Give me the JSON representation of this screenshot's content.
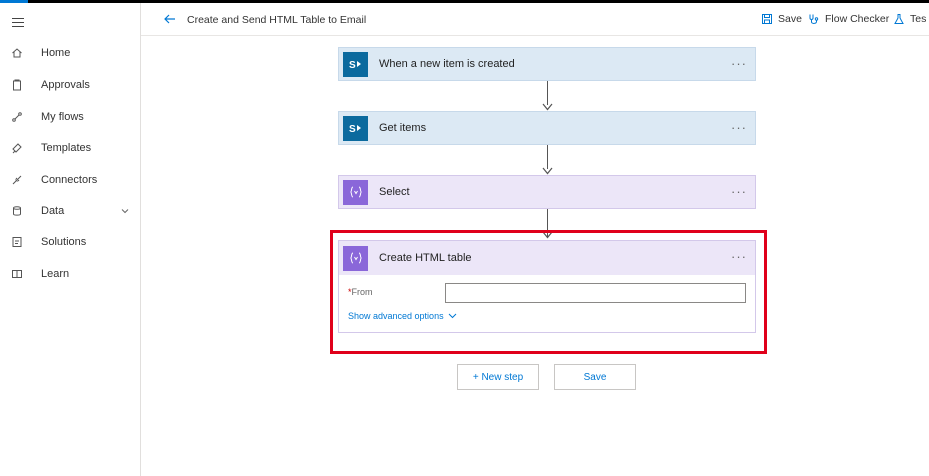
{
  "sidebar": {
    "items": [
      {
        "label": "Home",
        "icon": "home-icon"
      },
      {
        "label": "Approvals",
        "icon": "approvals-icon"
      },
      {
        "label": "My flows",
        "icon": "flows-icon"
      },
      {
        "label": "Templates",
        "icon": "templates-icon"
      },
      {
        "label": "Connectors",
        "icon": "connectors-icon"
      },
      {
        "label": "Data",
        "icon": "data-icon"
      },
      {
        "label": "Solutions",
        "icon": "solutions-icon"
      },
      {
        "label": "Learn",
        "icon": "learn-icon"
      }
    ]
  },
  "header": {
    "title": "Create and Send HTML Table to Email",
    "save_label": "Save",
    "checker_label": "Flow Checker",
    "test_label": "Tes"
  },
  "flow": {
    "steps": [
      {
        "title": "When a new item is created",
        "kind": "sharepoint"
      },
      {
        "title": "Get items",
        "kind": "sharepoint"
      },
      {
        "title": "Select",
        "kind": "data-operation"
      }
    ],
    "more_label": "···",
    "expanded": {
      "title": "Create HTML table",
      "from_required": "*",
      "from_label": "From",
      "from_value": "",
      "advanced_label": "Show advanced options"
    }
  },
  "footer": {
    "new_step_label": "+ New step",
    "save_label": "Save"
  },
  "colors": {
    "accent": "#0078d4",
    "sharepoint": "#0b6a9e",
    "data_operation": "#8a67d9",
    "highlight": "#e0001b"
  }
}
